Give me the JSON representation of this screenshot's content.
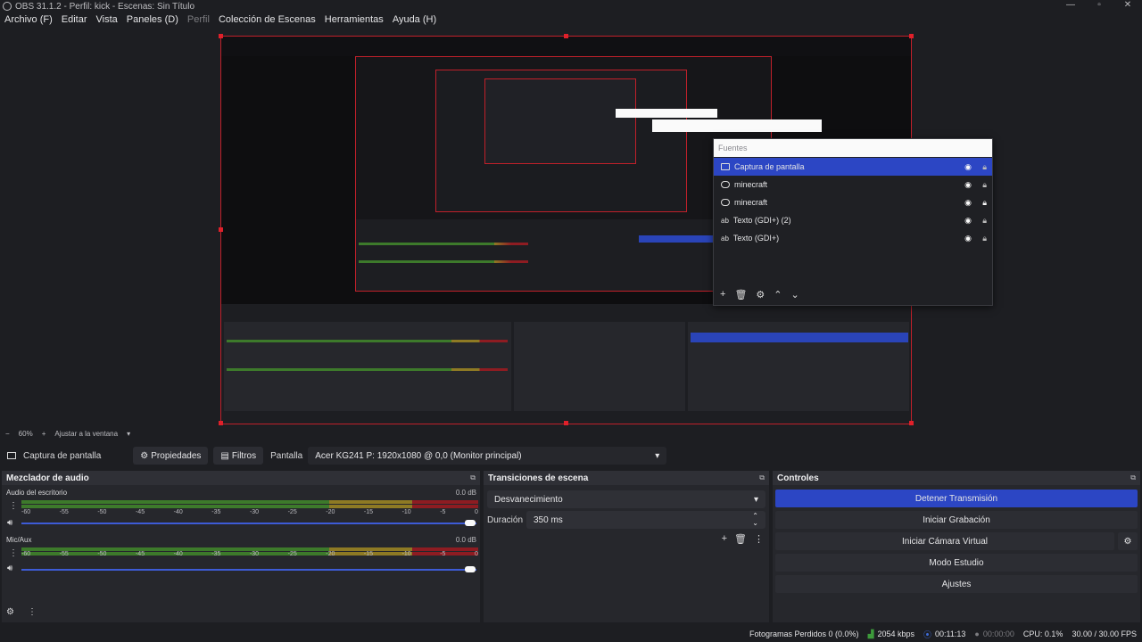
{
  "window": {
    "title": "OBS 31.1.2 - Perfil: kick - Escenas: Sin Título"
  },
  "menu": [
    "Archivo (F)",
    "Editar",
    "Vista",
    "Paneles (D)",
    "Perfil",
    "Colección de Escenas",
    "Herramientas",
    "Ayuda (H)"
  ],
  "sources_popup": {
    "header": "Fuentes",
    "items": [
      {
        "label": "Captura de pantalla",
        "selected": true,
        "icon": "monitor-icon"
      },
      {
        "label": "minecraft",
        "selected": false,
        "icon": "gamepad-icon"
      },
      {
        "label": "minecraft",
        "selected": false,
        "icon": "gamepad-icon"
      },
      {
        "label": "Texto (GDI+) (2)",
        "selected": false,
        "icon": "text-icon"
      },
      {
        "label": "Texto (GDI+)",
        "selected": false,
        "icon": "text-icon"
      }
    ]
  },
  "zoom": {
    "minus": "−",
    "value": "60%",
    "plus": "+",
    "fit": "Ajustar a la ventana"
  },
  "sourcebar": {
    "source": "Captura de pantalla",
    "properties": "Propiedades",
    "filters": "Filtros",
    "screen_label": "Pantalla",
    "screen_value": "Acer KG241 P: 1920x1080 @ 0,0 (Monitor principal)"
  },
  "mixer": {
    "title": "Mezclador de audio",
    "channels": [
      {
        "name": "Audio del escritorio",
        "db": "0.0 dB"
      },
      {
        "name": "Mic/Aux",
        "db": "0.0 dB"
      }
    ],
    "scale": [
      "-60",
      "-55",
      "-50",
      "-45",
      "-40",
      "-35",
      "-30",
      "-25",
      "-20",
      "-15",
      "-10",
      "-5",
      "0"
    ]
  },
  "transitions": {
    "title": "Transiciones de escena",
    "selected": "Desvanecimiento",
    "duration_label": "Duración",
    "duration_value": "350 ms"
  },
  "controls": {
    "title": "Controles",
    "buttons": [
      "Detener Transmisión",
      "Iniciar Grabación",
      "Iniciar Cámara Virtual",
      "Modo Estudio",
      "Ajustes"
    ]
  },
  "status": {
    "dropped": "Fotogramas Perdidos 0 (0.0%)",
    "bitrate": "2054 kbps",
    "stream_time": "00:11:13",
    "rec_time": "00:00:00",
    "cpu": "CPU: 0.1%",
    "fps": "30.00 / 30.00 FPS"
  },
  "colors": {
    "accent": "#2c46c4",
    "red": "#c0202a",
    "bg": "#1d1e22"
  }
}
